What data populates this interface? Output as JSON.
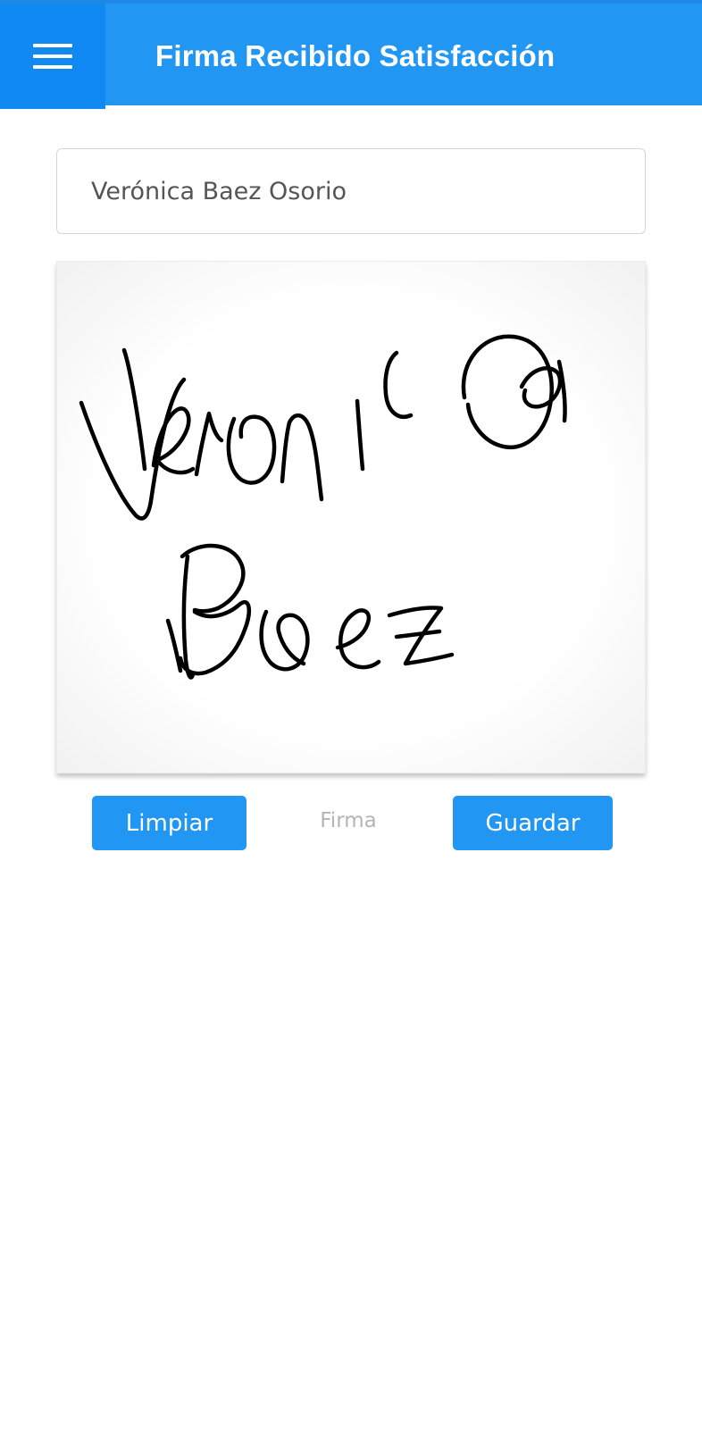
{
  "header": {
    "title": "Firma Recibido Satisfacción",
    "menu_icon": "hamburger-menu-icon",
    "background_color": "#2196f3",
    "menu_background_color": "#1089f2"
  },
  "form": {
    "name_value": "Verónica Baez Osorio"
  },
  "signature_pad": {
    "label": "Firma",
    "has_signature": true,
    "stroke_color": "#000000"
  },
  "actions": {
    "clear_label": "Limpiar",
    "save_label": "Guardar",
    "button_color": "#2196f3"
  }
}
